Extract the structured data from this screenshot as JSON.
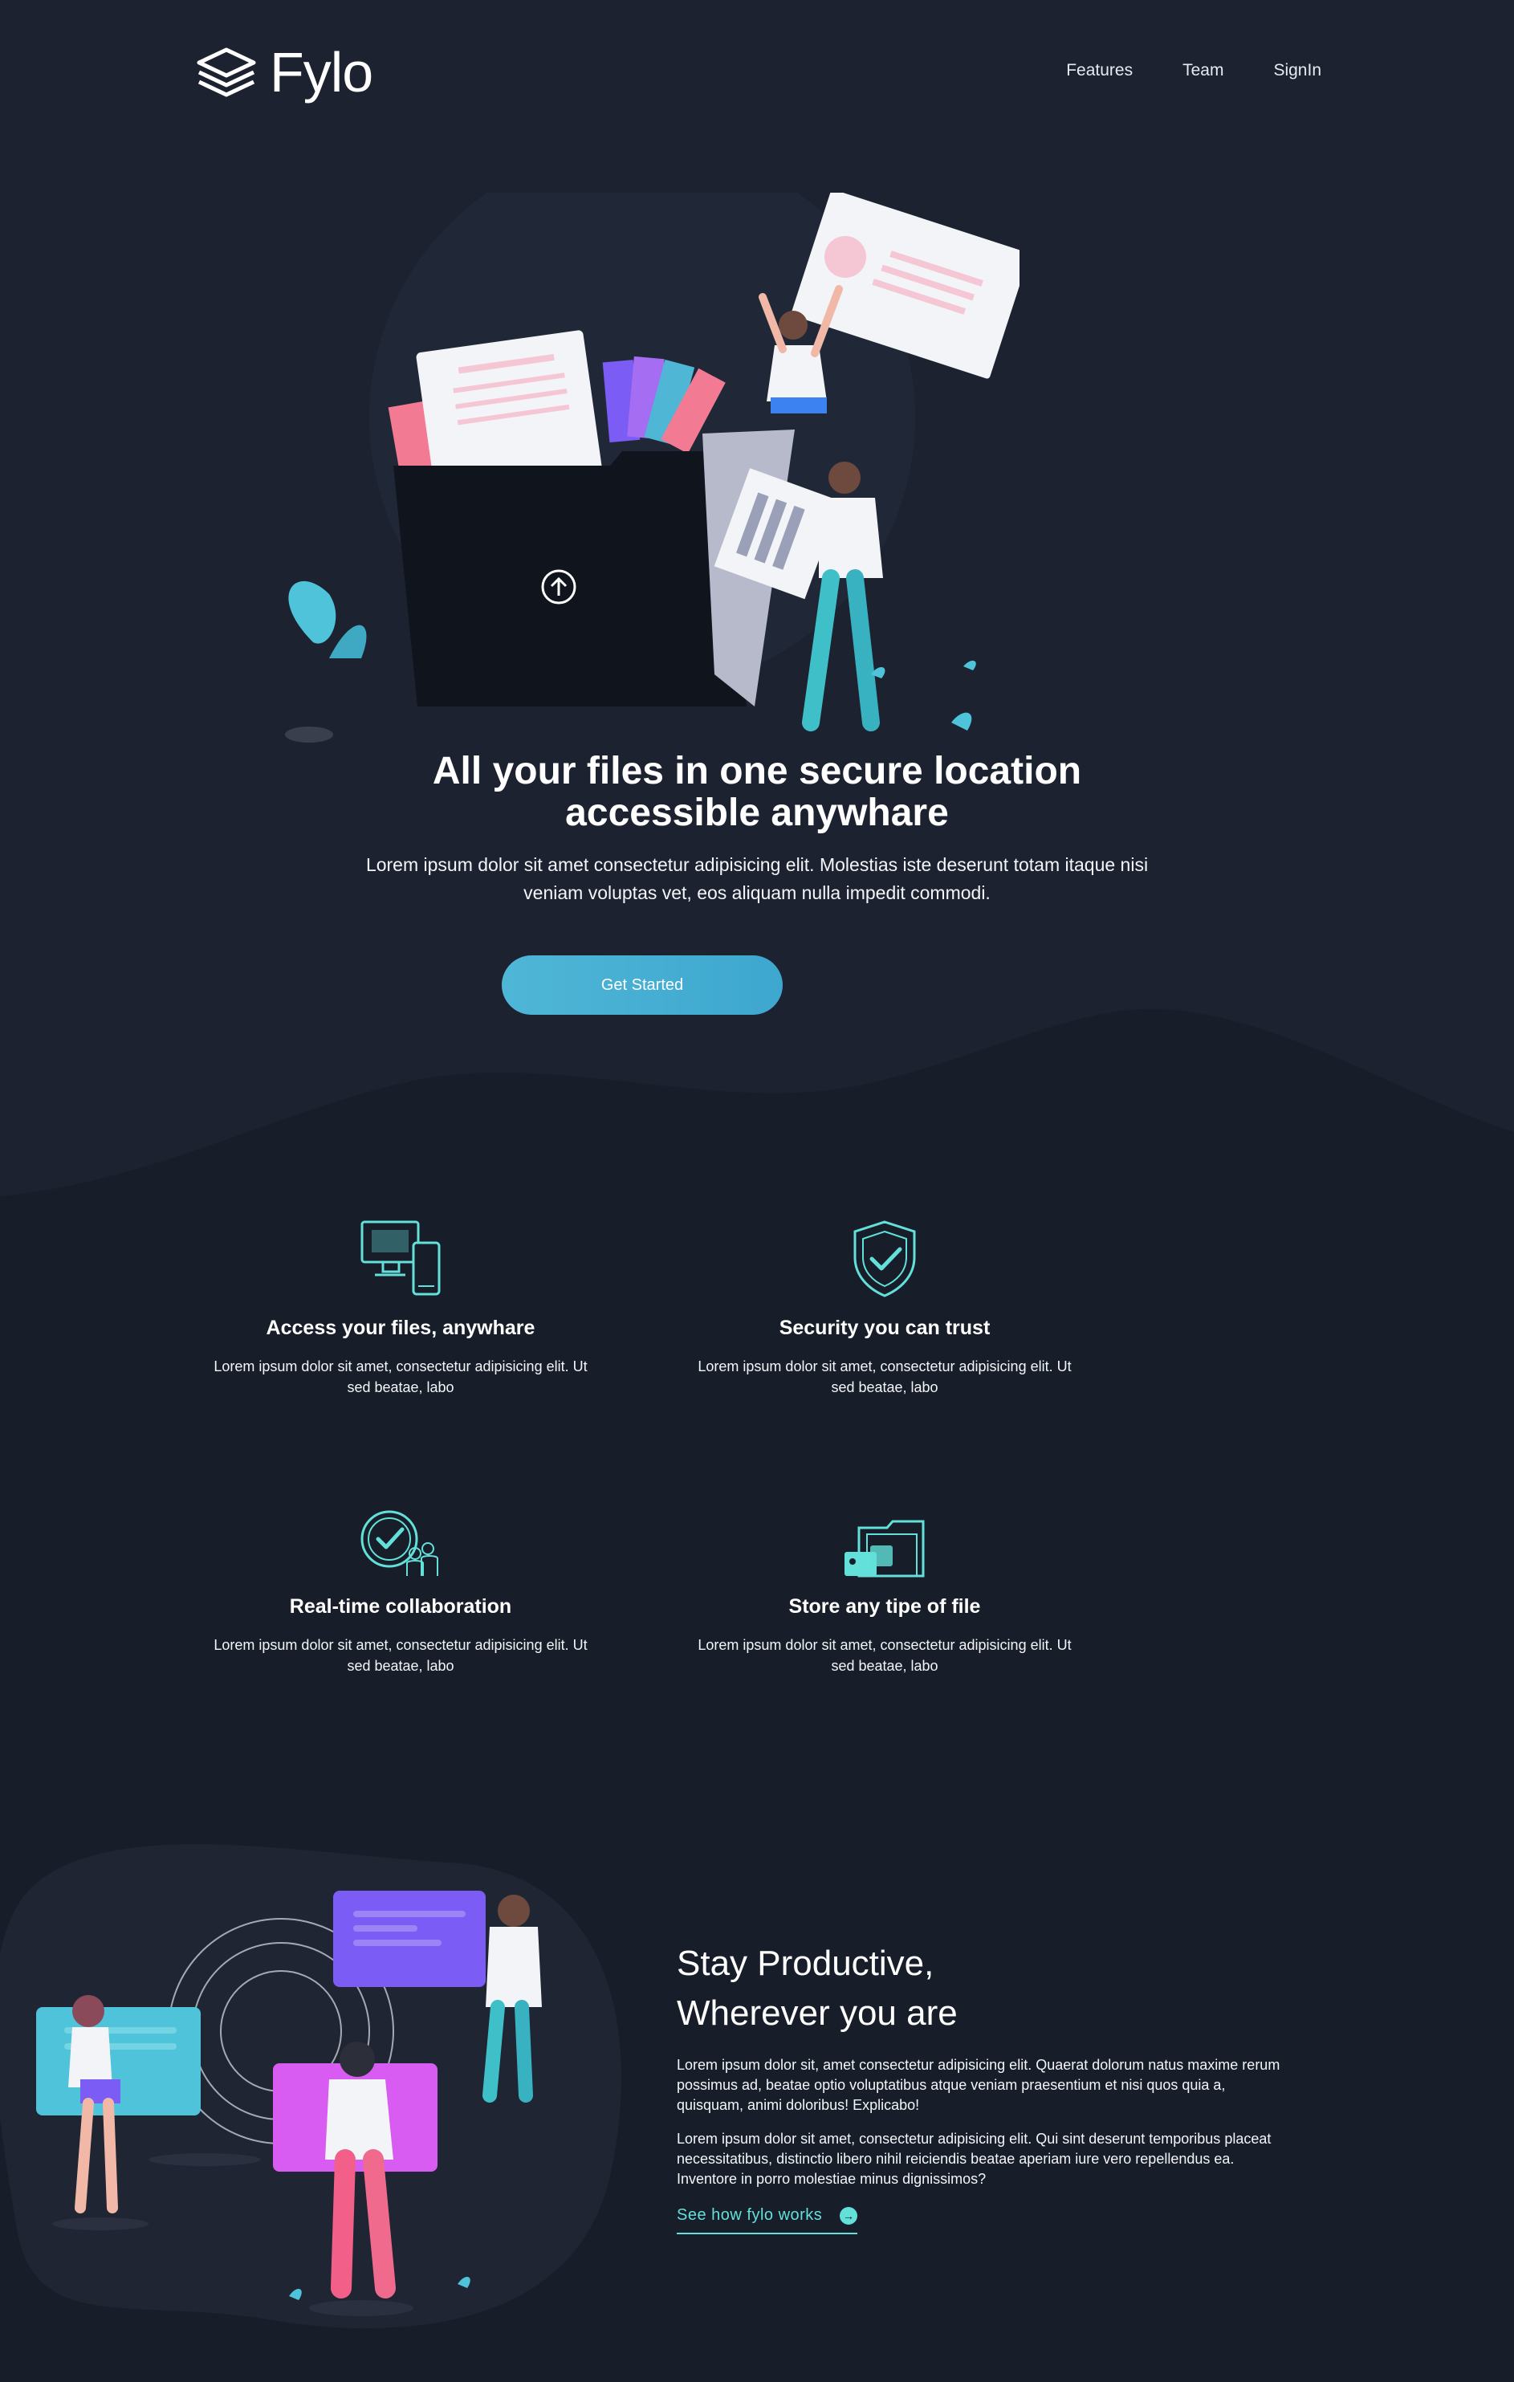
{
  "header": {
    "brand": "Fylo",
    "nav": [
      {
        "label": "Features"
      },
      {
        "label": "Team"
      },
      {
        "label": "SignIn"
      }
    ]
  },
  "hero": {
    "title_line1": "All your files in one secure location",
    "title_line2": "accessible anywhare",
    "text": "Lorem ipsum dolor sit amet consectetur adipisicing elit. Molestias iste deserunt totam itaque nisi veniam voluptas vet, eos aliquam nulla impedit commodi.",
    "cta_label": "Get Started"
  },
  "features": [
    {
      "icon": "devices-icon",
      "title": "Access your files, anywhare",
      "text": "Lorem ipsum dolor sit amet, consectetur adipisicing elit. Ut sed beatae, labo"
    },
    {
      "icon": "shield-check-icon",
      "title": "Security you can trust",
      "text": "Lorem ipsum dolor sit amet, consectetur adipisicing elit. Ut sed beatae, labo"
    },
    {
      "icon": "collaboration-icon",
      "title": "Real-time collaboration",
      "text": "Lorem ipsum dolor sit amet, consectetur adipisicing elit. Ut sed beatae, labo"
    },
    {
      "icon": "file-storage-icon",
      "title": "Store any tipe of file",
      "text": "Lorem ipsum dolor sit amet, consectetur adipisicing elit. Ut sed beatae, labo"
    }
  ],
  "productive": {
    "title_line1": "Stay Productive,",
    "title_line2": "Wherever you are",
    "p1": "Lorem ipsum dolor sit, amet consectetur adipisicing elit. Quaerat dolorum natus maxime rerum possimus ad, beatae optio voluptatibus atque veniam praesentium et nisi quos quia a, quisquam, animi doloribus! Explicabo!",
    "p2": "Lorem ipsum dolor sit amet, consectetur adipisicing elit. Qui sint deserunt temporibus placeat necessitatibus, distinctio libero nihil reiciendis beatae aperiam iure vero repellendus ea. Inventore in porro molestiae minus dignissimos?",
    "link_label": "See how fylo works"
  },
  "colors": {
    "background": "#181e29",
    "band": "#1c2230",
    "accent_cyan": "#62e0d9",
    "button": "#4fb6d6"
  }
}
